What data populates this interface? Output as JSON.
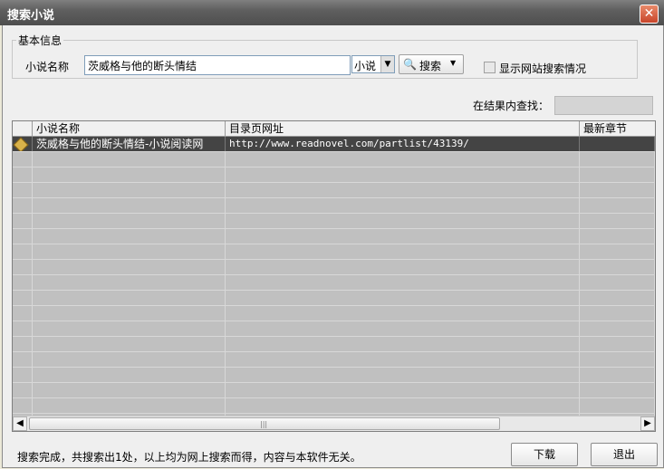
{
  "window": {
    "title": "搜索小说",
    "close_label": "✕"
  },
  "basic_info": {
    "legend": "基本信息",
    "name_label": "小说名称",
    "name_value": "茨威格与他的断头情结",
    "type_value": "小说",
    "search_label": "搜索",
    "show_search_label": "显示网站搜索情况",
    "show_search_checked": false
  },
  "find": {
    "label": "在结果内查找：",
    "value": ""
  },
  "grid": {
    "columns": [
      "",
      "小说名称",
      "目录页网址",
      "最新章节"
    ],
    "rows": [
      {
        "name": "茨威格与他的断头情结-小说阅读网",
        "url": "http://www.readnovel.com/partlist/43139/",
        "latest": ""
      }
    ],
    "empty_rows": 18
  },
  "status": {
    "text": "搜索完成，共搜索出1处，以上均为网上搜索而得，内容与本软件无关。"
  },
  "buttons": {
    "download": "下载",
    "exit": "退出"
  }
}
